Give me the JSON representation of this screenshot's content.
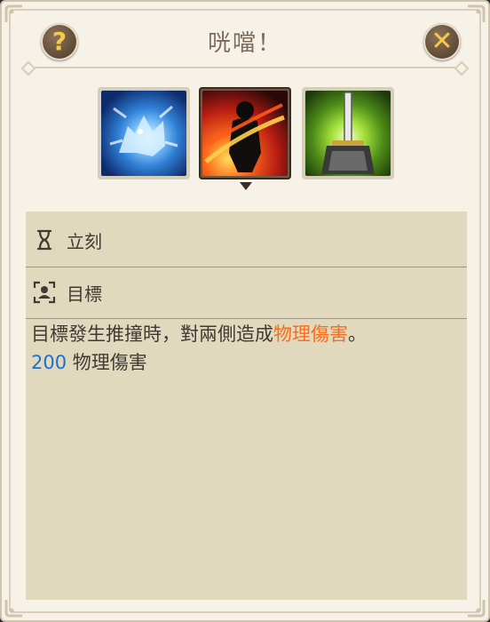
{
  "title": "咣噹！",
  "buttons": {
    "help_glyph": "?",
    "close_glyph": "✕"
  },
  "skills": [
    {
      "name": "frost-wolf",
      "selected": false
    },
    {
      "name": "shadow-strike",
      "selected": true
    },
    {
      "name": "holy-sword",
      "selected": false
    }
  ],
  "details": {
    "cast_time": "立刻",
    "target": "目標",
    "description_pre": "目標發生推撞時，對兩側造成",
    "description_highlight": "物理傷害",
    "description_post": "。",
    "damage_value": "200",
    "damage_type": "物理傷害"
  },
  "colors": {
    "highlight": "#ff6a14",
    "value": "#1d6fd0",
    "accent": "#f7c84a"
  }
}
